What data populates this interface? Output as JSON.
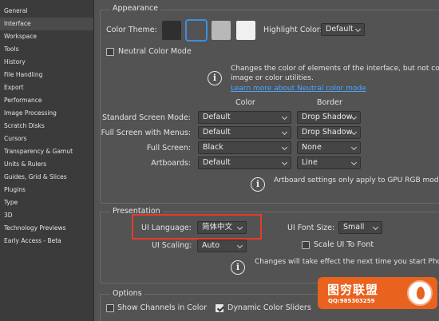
{
  "sidebar": {
    "items": [
      {
        "label": "General",
        "active": false
      },
      {
        "label": "Interface",
        "active": true
      },
      {
        "label": "Workspace",
        "active": false
      },
      {
        "label": "Tools",
        "active": false
      },
      {
        "label": "History",
        "active": false
      },
      {
        "label": "File Handling",
        "active": false
      },
      {
        "label": "Export",
        "active": false
      },
      {
        "label": "Performance",
        "active": false
      },
      {
        "label": "Image Processing",
        "active": false
      },
      {
        "label": "Scratch Disks",
        "active": false
      },
      {
        "label": "Cursors",
        "active": false
      },
      {
        "label": "Transparency & Gamut",
        "active": false
      },
      {
        "label": "Units & Rulers",
        "active": false
      },
      {
        "label": "Guides, Grid & Slices",
        "active": false
      },
      {
        "label": "Plugins",
        "active": false
      },
      {
        "label": "Type",
        "active": false
      },
      {
        "label": "3D",
        "active": false
      },
      {
        "label": "Technology Previews",
        "active": false
      },
      {
        "label": "Early Access - Beta",
        "active": false
      }
    ]
  },
  "appearance": {
    "legend": "Appearance",
    "color_theme_label": "Color Theme:",
    "swatches": [
      "#2f2f2f",
      "#535353",
      "#b8b8b8",
      "#f0f0f0"
    ],
    "highlight_color_label": "Highlight Color:",
    "highlight_color_value": "Default",
    "neutral_mode_label": "Neutral Color Mode",
    "neutral_mode_checked": false,
    "neutral_info_line1": "Changes the color of elements of the interface, but not colo",
    "neutral_info_line2": "image or color utilities.",
    "learn_more": "Learn more about Neutral color mode",
    "col_color": "Color",
    "col_border": "Border",
    "rows": [
      {
        "label": "Standard Screen Mode:",
        "color": "Default",
        "border": "Drop Shadow"
      },
      {
        "label": "Full Screen with Menus:",
        "color": "Default",
        "border": "Drop Shadow"
      },
      {
        "label": "Full Screen:",
        "color": "Black",
        "border": "None"
      },
      {
        "label": "Artboards:",
        "color": "Default",
        "border": "Line"
      }
    ],
    "artboard_note": "Artboard settings only apply to GPU RGB mode"
  },
  "presentation": {
    "legend": "Presentation",
    "ui_language_label": "UI Language:",
    "ui_language_value": "简体中文",
    "ui_font_size_label": "UI Font Size:",
    "ui_font_size_value": "Small",
    "scale_ui_label": "Scale UI To Font",
    "scale_ui_checked": false,
    "ui_scaling_label": "UI Scaling:",
    "ui_scaling_value": "Auto",
    "restart_note": "Changes will take effect the next time you start Photo"
  },
  "options": {
    "legend": "Options",
    "show_channels_label": "Show Channels in Color",
    "show_channels_checked": false,
    "dynamic_sliders_label": "Dynamic Color Sliders",
    "dynamic_sliders_checked": true
  },
  "watermark": {
    "title": "图穷联盟",
    "sub": "QQ:985303259"
  }
}
